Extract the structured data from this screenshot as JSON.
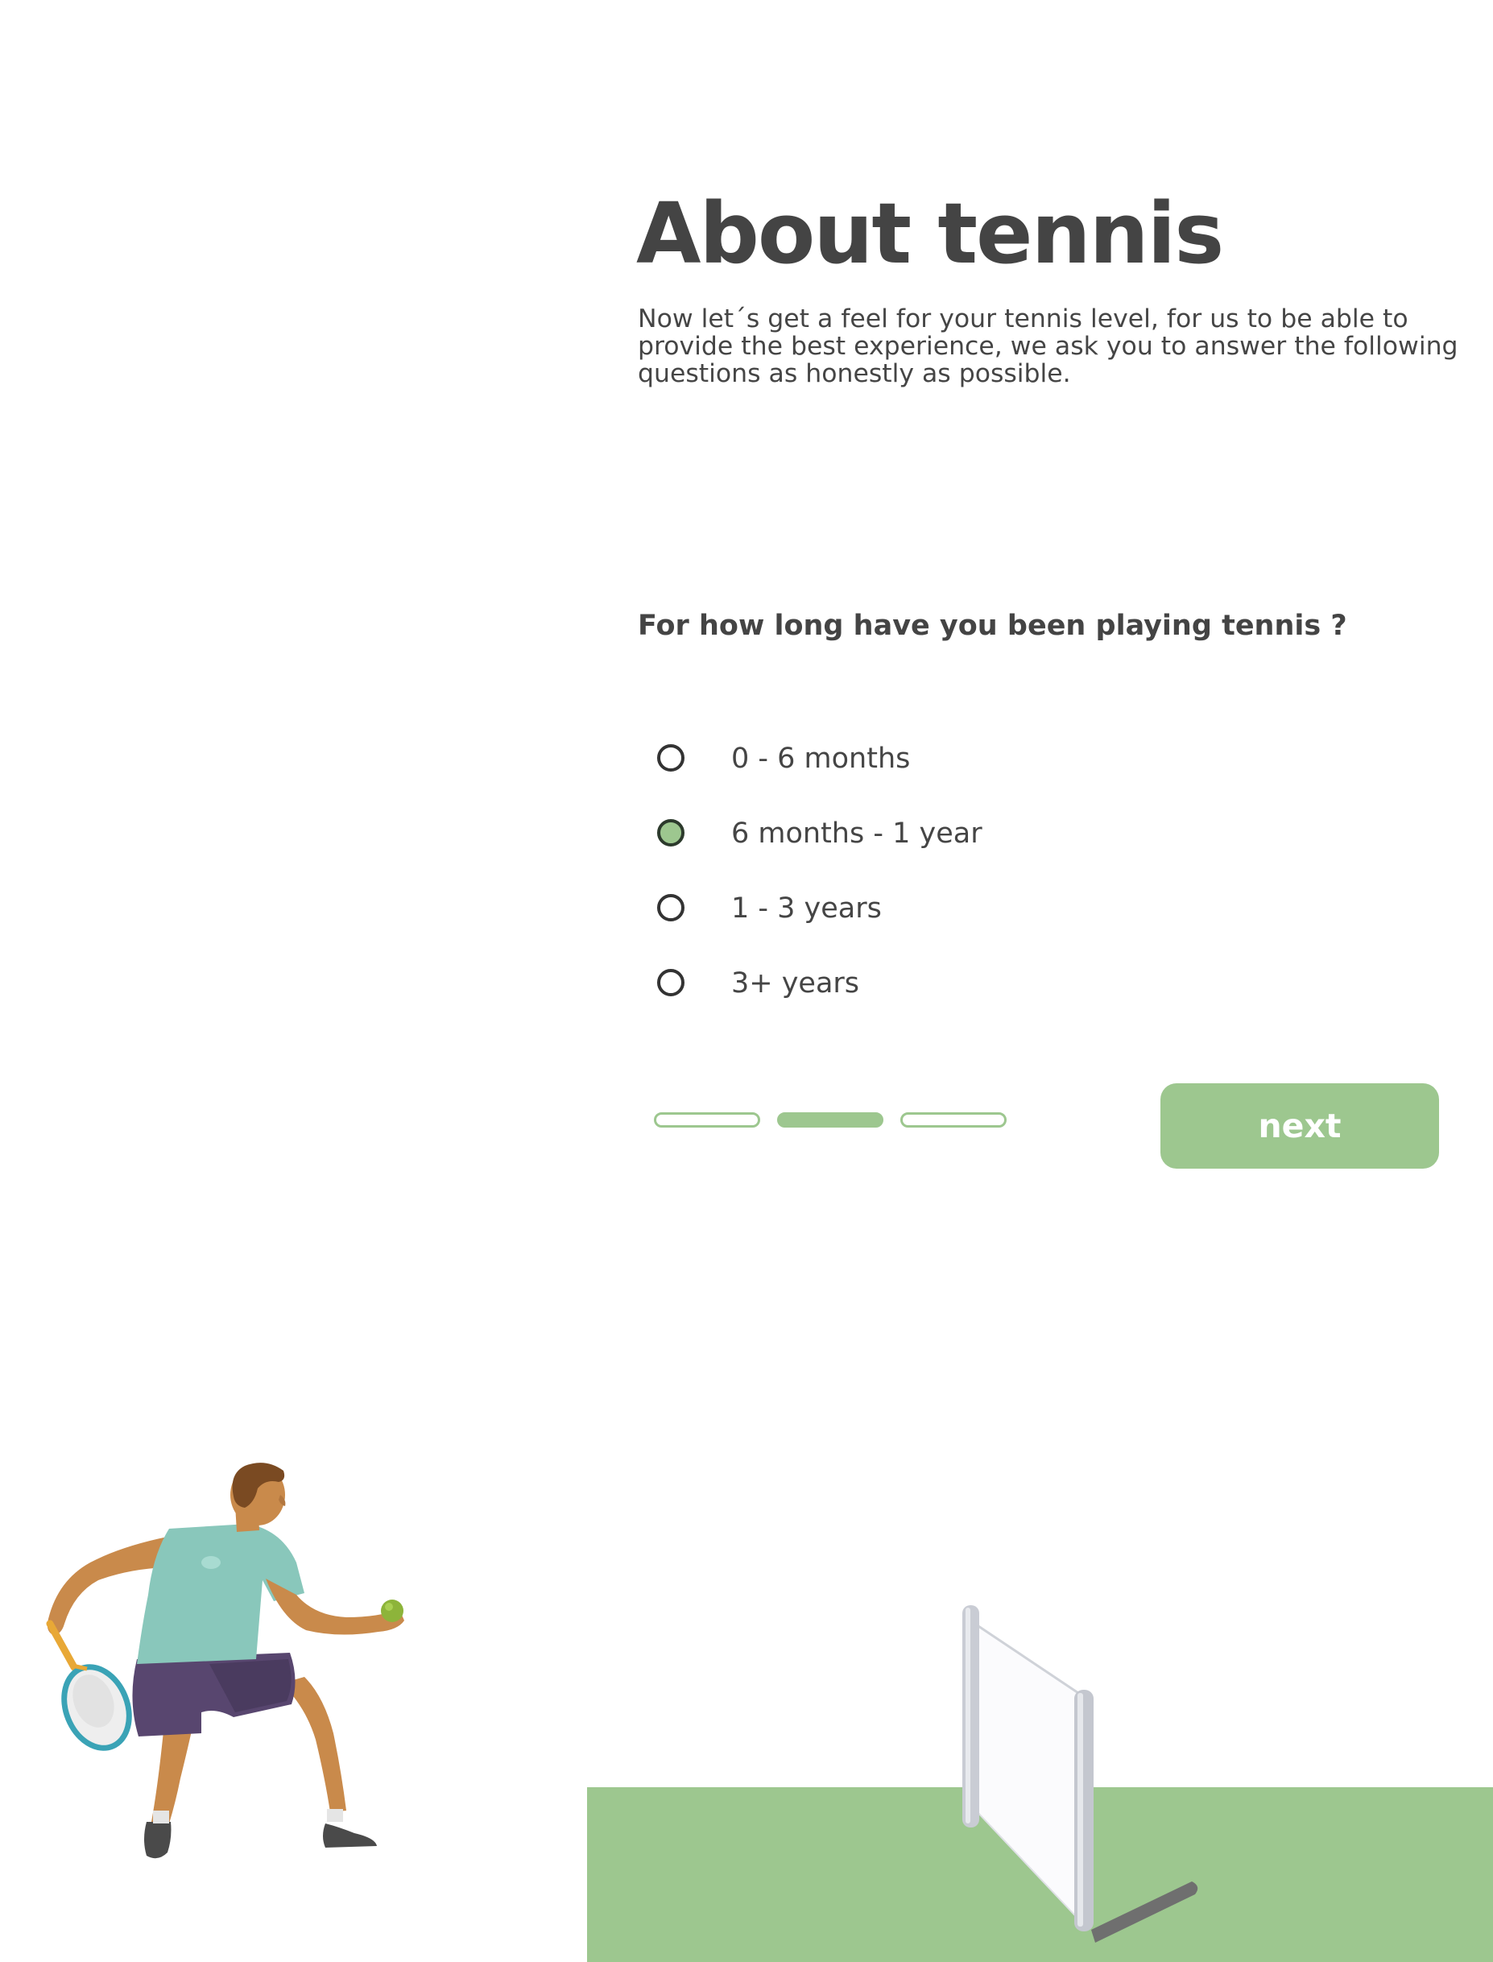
{
  "colors": {
    "accent": "#9dc78f",
    "text": "#444444",
    "court": "#9dc78f"
  },
  "header": {
    "title": "About tennis",
    "intro": "Now let´s get a feel for your tennis level, for us to be able to provide the best experience, we ask you to answer the following questions as honestly as possible."
  },
  "question": {
    "text": "For how long have you been playing tennis ?",
    "options": [
      {
        "label": "0 - 6 months",
        "selected": false
      },
      {
        "label": "6 months - 1 year",
        "selected": true
      },
      {
        "label": "1 - 3 years",
        "selected": false
      },
      {
        "label": "3+ years",
        "selected": false
      }
    ]
  },
  "progress": {
    "total_steps": 3,
    "current_step": 2
  },
  "actions": {
    "next_label": "next"
  },
  "illustrations": [
    {
      "name": "tennis-player-illustration"
    },
    {
      "name": "tennis-court-net-illustration"
    }
  ]
}
